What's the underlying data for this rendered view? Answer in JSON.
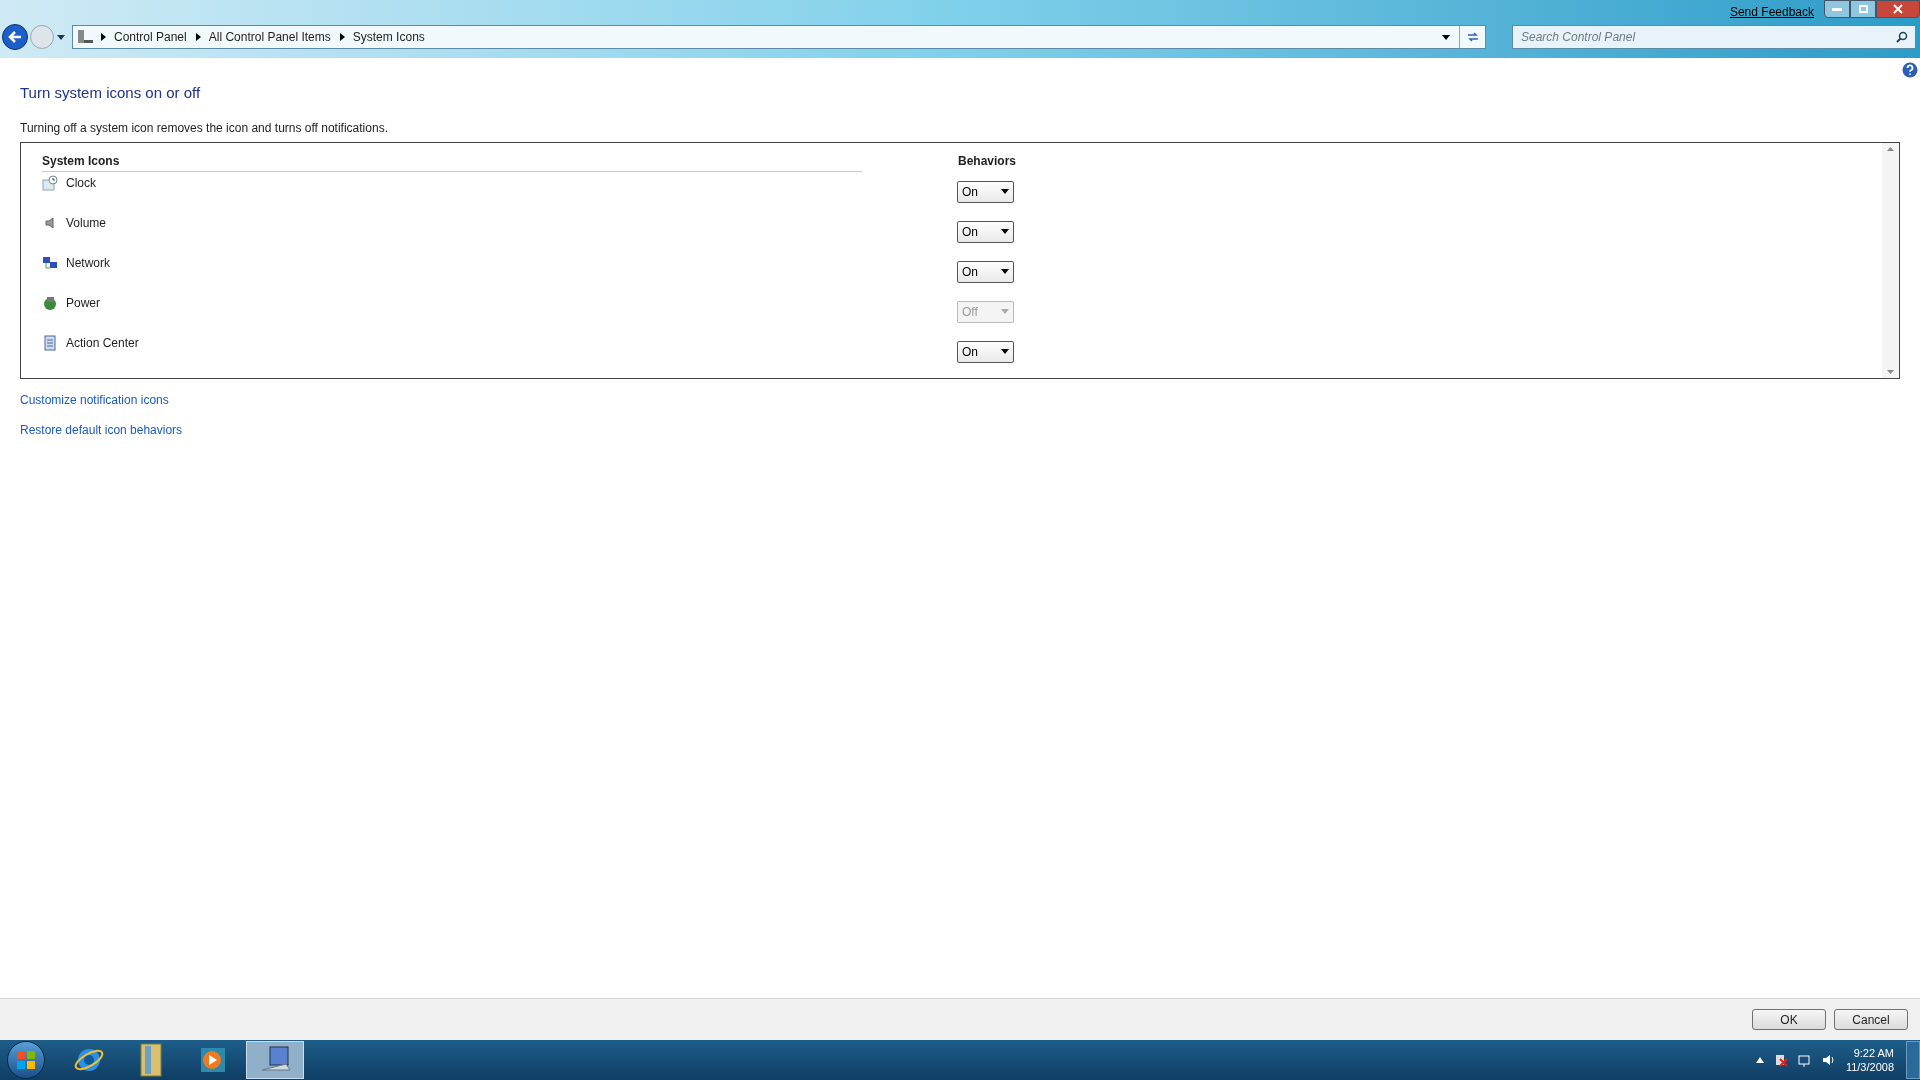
{
  "title_bar": {
    "feedback_link": "Send Feedback"
  },
  "address_bar": {
    "breadcrumb": [
      "Control Panel",
      "All Control Panel Items",
      "System Icons"
    ],
    "search": {
      "placeholder": "Search Control Panel"
    }
  },
  "page": {
    "heading": "Turn system icons on or off",
    "description": "Turning off a system icon removes the icon and turns off notifications."
  },
  "table": {
    "columns": [
      "System Icons",
      "Behaviors"
    ],
    "rows": [
      {
        "kind": "clock",
        "name": "Clock",
        "value": "On",
        "disabled": false
      },
      {
        "kind": "volume",
        "name": "Volume",
        "value": "On",
        "disabled": false
      },
      {
        "kind": "network",
        "name": "Network",
        "value": "On",
        "disabled": false
      },
      {
        "kind": "power",
        "name": "Power",
        "value": "Off",
        "disabled": true
      },
      {
        "kind": "action",
        "name": "Action Center",
        "value": "On",
        "disabled": false
      }
    ]
  },
  "links": [
    "Customize notification icons",
    "Restore default icon behaviors"
  ],
  "buttons": [
    "OK",
    "Cancel"
  ],
  "taskbar": {
    "items": [
      {
        "kind": "browser",
        "selected": false
      },
      {
        "kind": "folder",
        "selected": false
      },
      {
        "kind": "media",
        "selected": false
      },
      {
        "kind": "control",
        "selected": true
      }
    ],
    "time": "9:22 AM",
    "date": "11/3/2008"
  }
}
